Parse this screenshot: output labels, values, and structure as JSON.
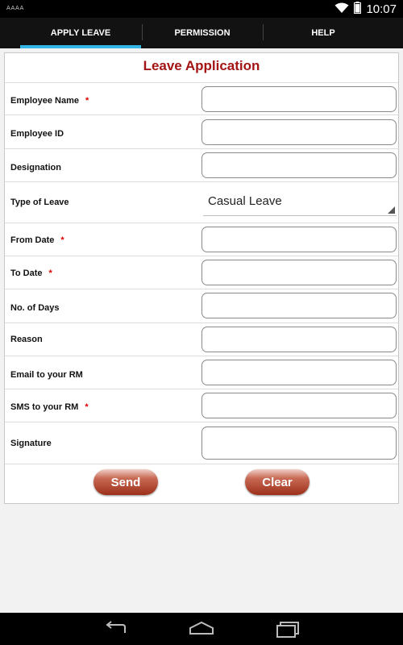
{
  "status_bar": {
    "time": "10:07",
    "notification_text": "AAAA",
    "icons": [
      "wifi-icon",
      "battery-icon"
    ]
  },
  "tabs": [
    {
      "label": "APPLY LEAVE",
      "selected": true
    },
    {
      "label": "PERMISSION",
      "selected": false
    },
    {
      "label": "HELP",
      "selected": false
    }
  ],
  "form": {
    "title": "Leave Application",
    "fields": {
      "employee_name": {
        "label": "Employee Name",
        "required_marker": "*",
        "value": ""
      },
      "employee_id": {
        "label": "Employee ID",
        "value": ""
      },
      "designation": {
        "label": "Designation",
        "value": ""
      },
      "type_of_leave": {
        "label": "Type of Leave",
        "selected": "Casual Leave"
      },
      "from_date": {
        "label": "From Date",
        "required_marker": "*",
        "value": ""
      },
      "to_date": {
        "label": "To Date",
        "required_marker": "*",
        "value": ""
      },
      "no_of_days": {
        "label": "No. of Days",
        "value": ""
      },
      "reason": {
        "label": "Reason",
        "value": ""
      },
      "email_rm": {
        "label": "Email to your RM",
        "value": ""
      },
      "sms_rm": {
        "label": "SMS to your RM",
        "required_marker": "*",
        "value": ""
      },
      "signature": {
        "label": "Signature",
        "value": ""
      }
    },
    "buttons": {
      "send": "Send",
      "clear": "Clear"
    }
  },
  "colors": {
    "title": "#a31515",
    "tab_indicator": "#33b5e5",
    "button": "#b5452f",
    "required": "#dd0000"
  },
  "nav_bar": {
    "icons": [
      "back-icon",
      "home-icon",
      "recent-apps-icon"
    ]
  }
}
